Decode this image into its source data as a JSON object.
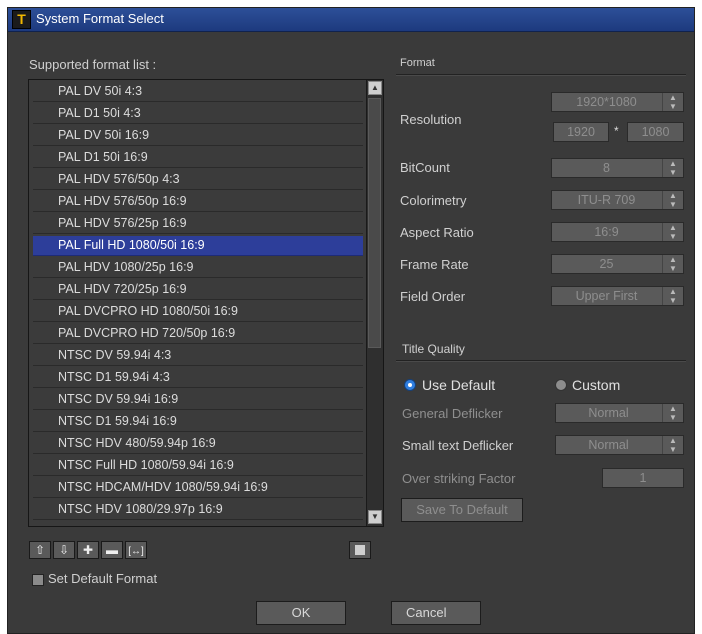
{
  "window": {
    "title": "System Format Select"
  },
  "list": {
    "label": "Supported format list :",
    "items": [
      "PAL DV 50i 4:3",
      "PAL D1 50i 4:3",
      "PAL DV 50i 16:9",
      "PAL D1 50i 16:9",
      "PAL HDV 576/50p 4:3",
      "PAL HDV 576/50p 16:9",
      "PAL HDV 576/25p 16:9",
      "PAL Full HD 1080/50i 16:9",
      "PAL HDV 1080/25p 16:9",
      "PAL HDV 720/25p 16:9",
      "PAL DVCPRO HD 1080/50i 16:9",
      "PAL DVCPRO HD 720/50p 16:9",
      "NTSC DV 59.94i 4:3",
      "NTSC D1 59.94i 4:3",
      "NTSC DV 59.94i 16:9",
      "NTSC D1 59.94i 16:9",
      "NTSC HDV 480/59.94p 16:9",
      "NTSC Full HD 1080/59.94i 16:9",
      "NTSC HDCAM/HDV 1080/59.94i 16:9",
      "NTSC HDV 1080/29.97p 16:9"
    ],
    "selected": "PAL Full HD 1080/50i 16:9"
  },
  "toolbar": {
    "move_up_icon": "arrow-up-icon",
    "move_down_icon": "arrow-down-icon",
    "add_icon": "plus-icon",
    "remove_icon": "minus-icon",
    "edit_icon": "resize-icon",
    "toggle_icon": "square-icon"
  },
  "set_default": {
    "label": "Set Default Format",
    "checked": false
  },
  "format": {
    "heading": "Format",
    "resolution_label": "Resolution",
    "resolution_value": "1920*1080",
    "width_value": "1920",
    "times": "*",
    "height_value": "1080",
    "bitcount_label": "BitCount",
    "bitcount_value": "8",
    "colorimetry_label": "Colorimetry",
    "colorimetry_value": "ITU-R 709",
    "aspect_label": "Aspect Ratio",
    "aspect_value": "16:9",
    "framerate_label": "Frame Rate",
    "framerate_value": "25",
    "fieldorder_label": "Field Order",
    "fieldorder_value": "Upper First"
  },
  "quality": {
    "heading": "Title Quality",
    "use_default_label": "Use Default",
    "custom_label": "Custom",
    "selected_option": "Use Default",
    "general_label": "General Deflicker",
    "general_value": "Normal",
    "small_label": "Small text Deflicker",
    "small_value": "Normal",
    "overstrike_label": "Over striking Factor",
    "overstrike_value": "1",
    "save_label": "Save To Default"
  },
  "buttons": {
    "ok": "OK",
    "cancel": "Cancel"
  },
  "colors": {
    "titlebar": "#23428a",
    "selection": "#2d3e9a",
    "panel": "#3a3a3a",
    "radio_on": "#2f7ee0"
  }
}
